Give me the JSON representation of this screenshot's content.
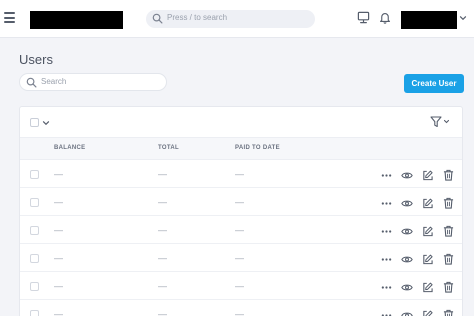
{
  "header": {
    "search_placeholder": "Press / to search"
  },
  "page": {
    "title": "Users",
    "search_placeholder": "Search",
    "create_button_label": "Create User"
  },
  "table": {
    "columns": [
      "BALANCE",
      "TOTAL",
      "PAID TO DATE"
    ],
    "rows": [
      [
        "—",
        "—",
        "—"
      ],
      [
        "—",
        "—",
        "—"
      ],
      [
        "—",
        "—",
        "—"
      ],
      [
        "—",
        "—",
        "—"
      ],
      [
        "—",
        "—",
        "—"
      ],
      [
        "—",
        "—",
        "—"
      ]
    ],
    "row_actions": [
      "more-icon",
      "eye-icon",
      "edit-icon",
      "trash-icon"
    ]
  },
  "colors": {
    "accent": "#1aa1e6",
    "icon": "#555d6b"
  }
}
